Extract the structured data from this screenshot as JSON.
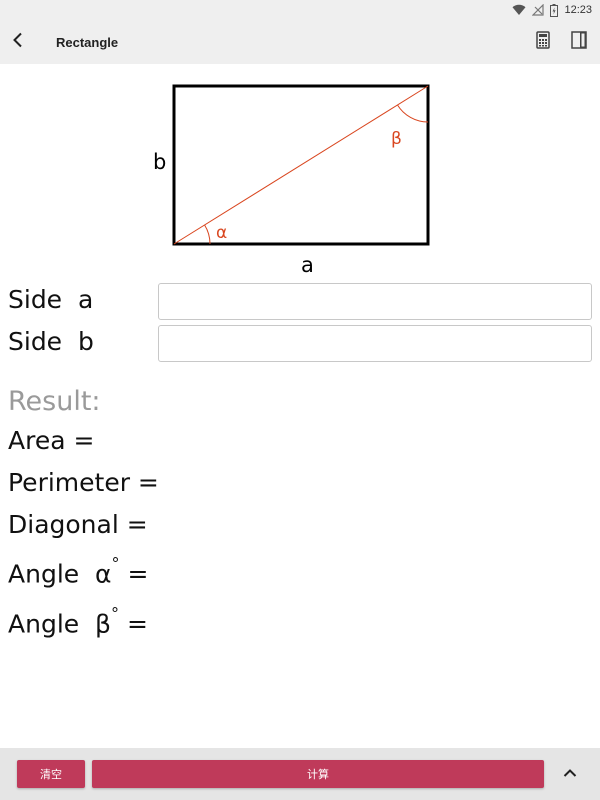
{
  "status_bar": {
    "time": "12:23"
  },
  "app_bar": {
    "title": "Rectangle"
  },
  "diagram": {
    "side_a_label": "a",
    "side_b_label": "b",
    "alpha_label": "α",
    "beta_label": "β",
    "colors": {
      "outline": "#000000",
      "diagonal": "#d9461f",
      "angle": "#d9461f"
    }
  },
  "inputs": [
    {
      "label": "Side  a",
      "value": ""
    },
    {
      "label": "Side  b",
      "value": ""
    }
  ],
  "results": {
    "title": "Result:",
    "area": "Area =",
    "perimeter": "Perimeter =",
    "diagonal": "Diagonal =",
    "angle_alpha": "Angle  α",
    "angle_beta": "Angle  β",
    "degree": "°",
    "equals": " ="
  },
  "buttons": {
    "clear": "清空",
    "calculate": "计算"
  },
  "colors": {
    "accent": "#bf3a5a",
    "bar_background": "#efefef",
    "result_title": "#9a9a9a"
  }
}
